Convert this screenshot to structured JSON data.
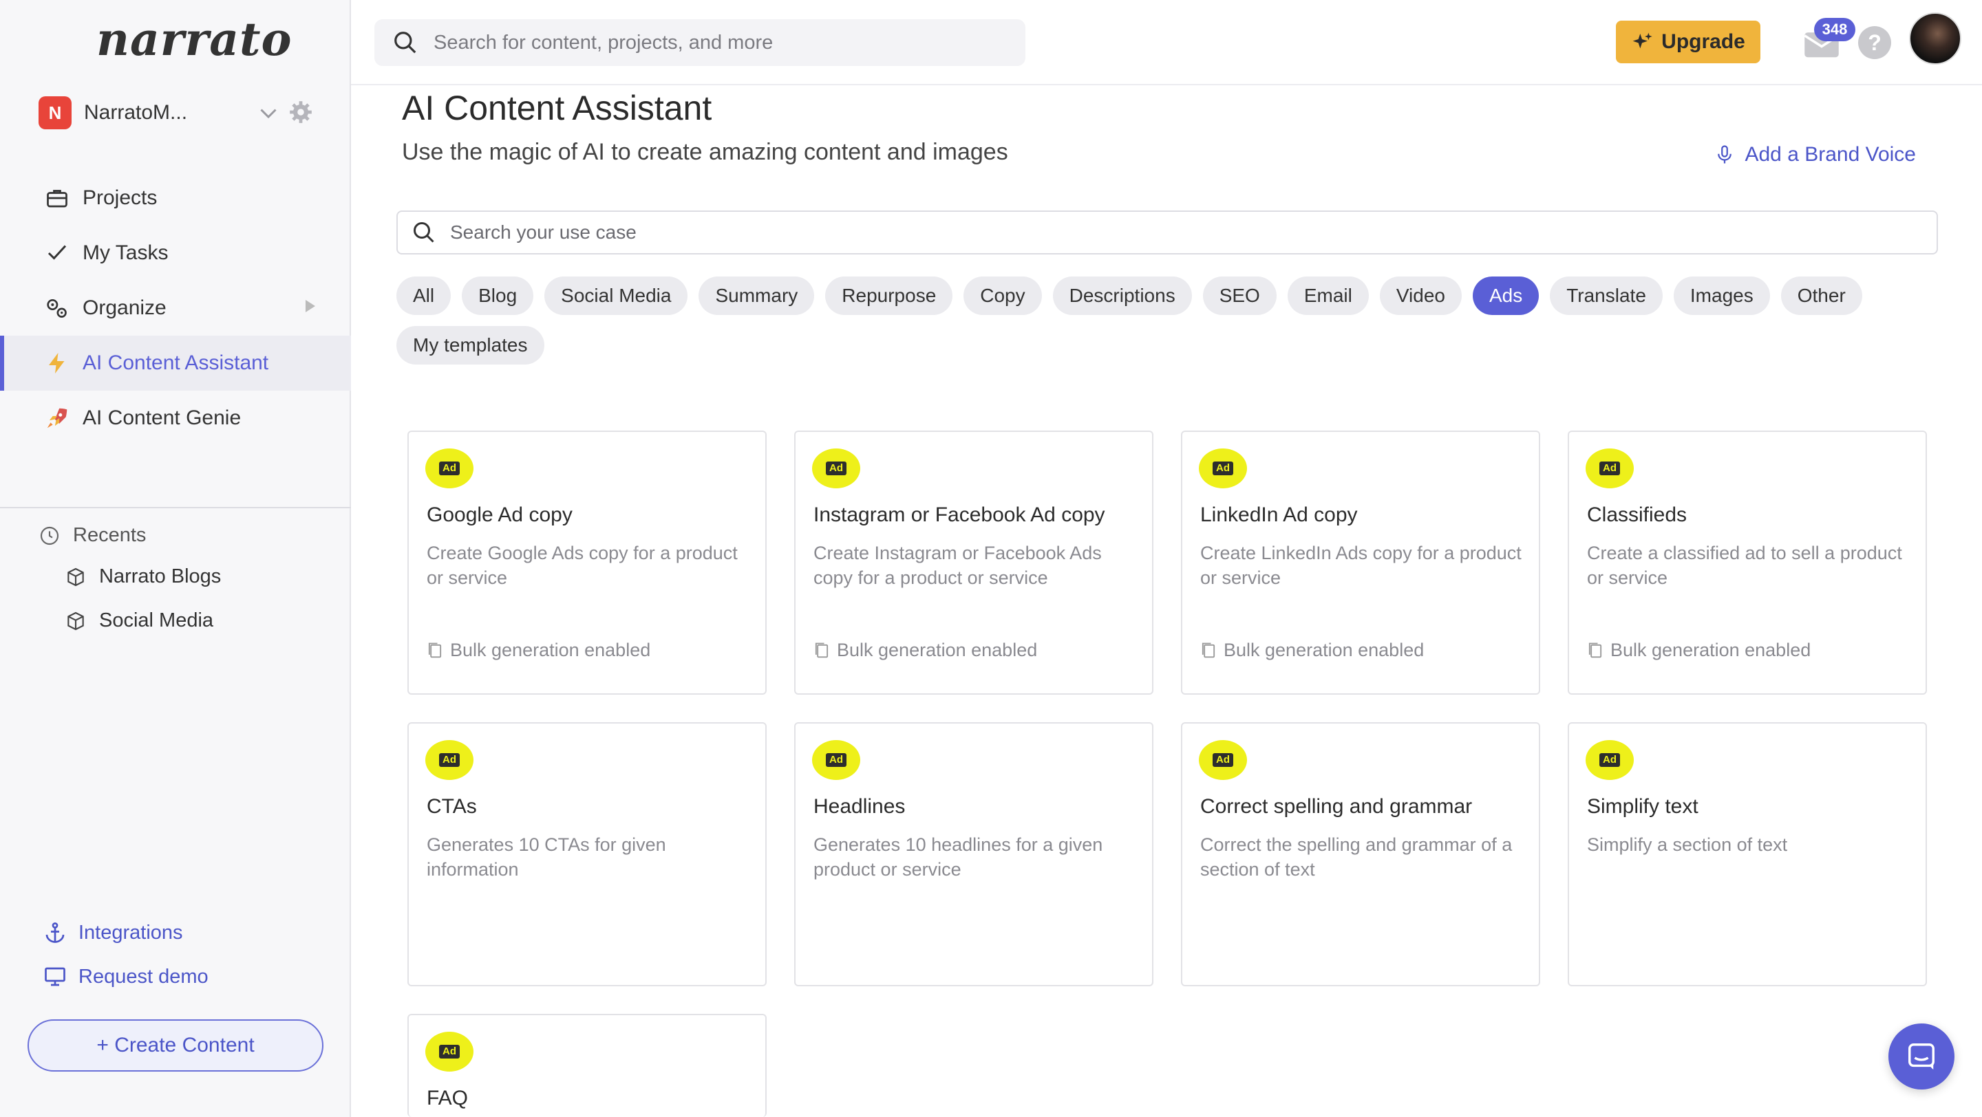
{
  "brand": {
    "logo_text": "narrato"
  },
  "workspace": {
    "initial": "N",
    "name": "NarratoM..."
  },
  "nav": [
    {
      "label": "Projects",
      "icon": "briefcase-icon"
    },
    {
      "label": "My Tasks",
      "icon": "checkmark-icon"
    },
    {
      "label": "Organize",
      "icon": "gears-icon"
    },
    {
      "label": "AI Content Assistant",
      "icon": "lightning-icon",
      "active": true
    },
    {
      "label": "AI Content Genie",
      "icon": "rocket-icon"
    }
  ],
  "recents": {
    "title": "Recents",
    "items": [
      {
        "label": "Narrato Blogs",
        "icon": "cube-icon"
      },
      {
        "label": "Social Media",
        "icon": "cube-icon"
      }
    ]
  },
  "bottom_links": {
    "integrations": "Integrations",
    "request_demo": "Request demo",
    "create_content": "+ Create Content"
  },
  "topbar": {
    "search_placeholder": "Search for content, projects, and more",
    "upgrade_label": "Upgrade",
    "mail_count": "348",
    "help_label": "?"
  },
  "main": {
    "title": "AI Content Assistant",
    "subtitle": "Use the magic of AI to create amazing content and images",
    "brand_voice_label": "Add a Brand Voice",
    "usecase_placeholder": "Search your use case",
    "filters": [
      "All",
      "Blog",
      "Social Media",
      "Summary",
      "Repurpose",
      "Copy",
      "Descriptions",
      "SEO",
      "Email",
      "Video",
      "Ads",
      "Translate",
      "Images",
      "Other",
      "My templates"
    ],
    "active_filter": "Ads",
    "cards": [
      {
        "title": "Google Ad copy",
        "desc": "Create Google Ads copy for a product or service",
        "bulk": "Bulk generation enabled"
      },
      {
        "title": "Instagram or Facebook Ad copy",
        "desc": "Create Instagram or Facebook Ads copy for a product or service",
        "bulk": "Bulk generation enabled"
      },
      {
        "title": "LinkedIn Ad copy",
        "desc": "Create LinkedIn Ads copy for a product or service",
        "bulk": "Bulk generation enabled"
      },
      {
        "title": "Classifieds",
        "desc": "Create a classified ad to sell a product or service",
        "bulk": "Bulk generation enabled"
      },
      {
        "title": "CTAs",
        "desc": "Generates 10 CTAs for given information",
        "bulk": ""
      },
      {
        "title": "Headlines",
        "desc": "Generates 10 headlines for a given product or service",
        "bulk": ""
      },
      {
        "title": "Correct spelling and grammar",
        "desc": "Correct the spelling and grammar of a section of text",
        "bulk": ""
      },
      {
        "title": "Simplify text",
        "desc": "Simplify a section of text",
        "bulk": ""
      },
      {
        "title": "FAQ",
        "desc": "",
        "bulk": ""
      }
    ],
    "card_badge": "Ad"
  },
  "colors": {
    "accent": "#5a5fd6",
    "upgrade": "#f0b43c",
    "badge_yellow": "#eef01a",
    "workspace_red": "#e8443a"
  }
}
